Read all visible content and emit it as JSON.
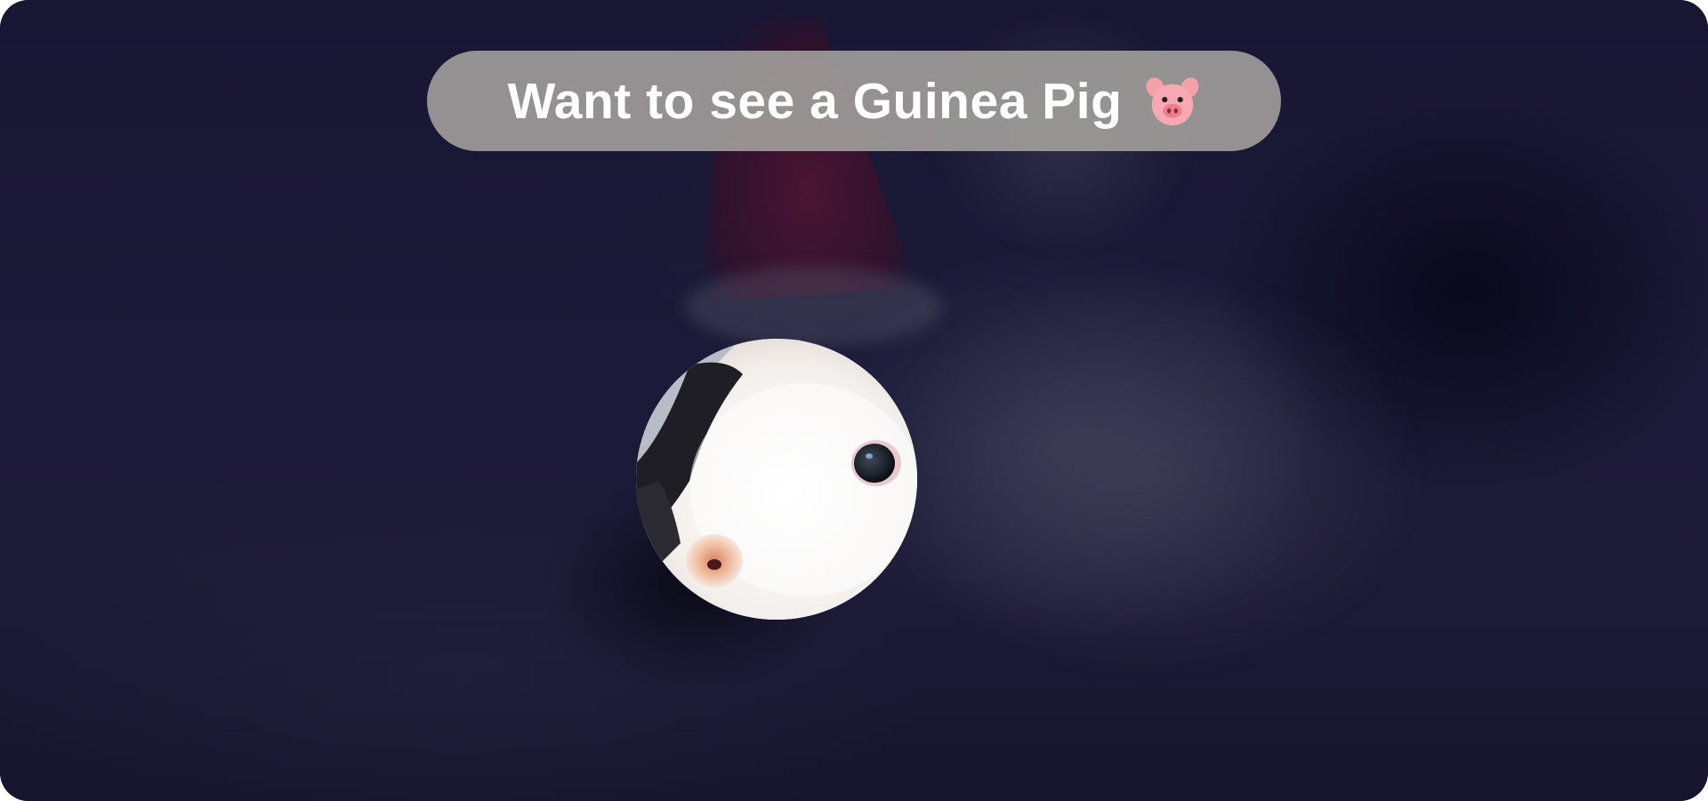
{
  "banner": {
    "title": "Want to see a Guinea Pig",
    "icon": "pig-face-icon"
  },
  "photo": {
    "subject": "guinea-pig-closeup-icon"
  },
  "colors": {
    "background": "#15132c",
    "pill": "#a09c9a",
    "title_text": "#ffffff"
  }
}
